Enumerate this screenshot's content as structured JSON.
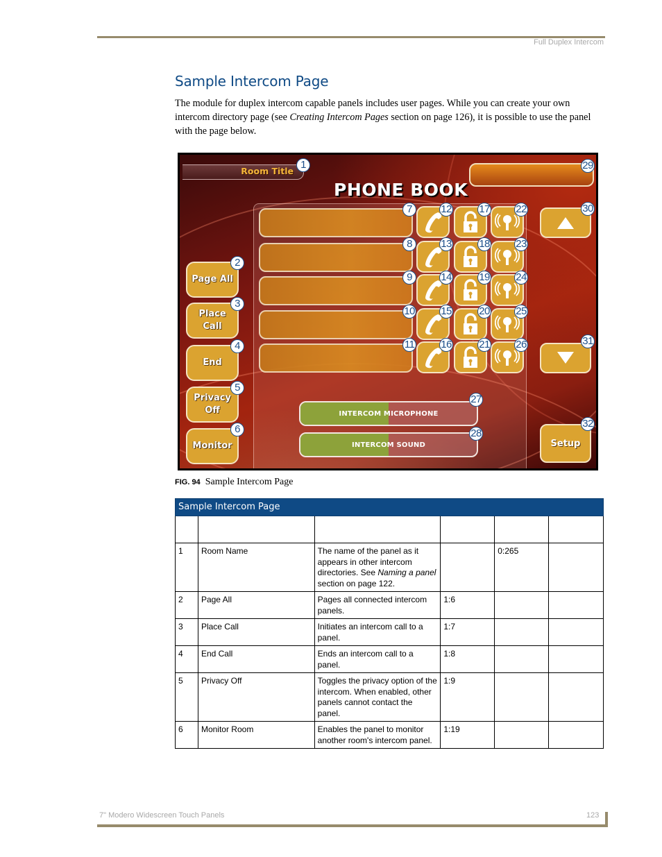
{
  "header": {
    "running_head": "Full Duplex Intercom"
  },
  "section": {
    "title": "Sample Intercom Page",
    "intro_before": "The module for duplex intercom capable panels includes user pages. While you can create your own intercom directory page (see ",
    "intro_link": "Creating Intercom Pages",
    "intro_after": " section on page 126), it is possible to use the panel with the page below."
  },
  "panel": {
    "room_title": "Room Title",
    "title": "PHONE BOOK",
    "side_buttons": [
      {
        "label": "Page All",
        "callout": "2"
      },
      {
        "label": "Place Call",
        "callout": "3"
      },
      {
        "label": "End",
        "callout": "4"
      },
      {
        "label": "Privacy Off",
        "callout": "5"
      },
      {
        "label": "Monitor",
        "callout": "6"
      }
    ],
    "rows": [
      {
        "entry_callout": "7",
        "call_callout": "12",
        "lock_callout": "17",
        "monitor_callout": "22"
      },
      {
        "entry_callout": "8",
        "call_callout": "13",
        "lock_callout": "18",
        "monitor_callout": "23"
      },
      {
        "entry_callout": "9",
        "call_callout": "14",
        "lock_callout": "19",
        "monitor_callout": "24"
      },
      {
        "entry_callout": "10",
        "call_callout": "15",
        "lock_callout": "20",
        "monitor_callout": "25"
      },
      {
        "entry_callout": "11",
        "call_callout": "16",
        "lock_callout": "21",
        "monitor_callout": "26"
      }
    ],
    "icons": {
      "call": "phone-handset-icon",
      "lock": "unlock-padlock-icon",
      "monitor": "monitor-speaker-icon",
      "up": "up-arrow-icon",
      "down": "down-arrow-icon"
    },
    "bars": [
      {
        "label": "INTERCOM MICROPHONE",
        "level_percent": 50,
        "callout": "27"
      },
      {
        "label": "INTERCOM SOUND",
        "level_percent": 50,
        "callout": "28"
      }
    ],
    "room_title_callout": "1",
    "field_callout": "29",
    "up_callout": "30",
    "down_callout": "31",
    "setup": {
      "label": "Setup",
      "callout": "32"
    },
    "colors": {
      "button_gold": "#dba330",
      "bar_green": "#8da23a",
      "callout_blue": "#1c4f8a"
    }
  },
  "figure": {
    "number": "FIG. 94",
    "caption": "Sample Intercom Page"
  },
  "table": {
    "title": "Sample Intercom Page",
    "rows": [
      {
        "num": "1",
        "name": "Room Name",
        "desc_parts": [
          "The name of the panel as it appears in other intercom directories. See ",
          "Naming a panel",
          " section on page 122."
        ],
        "c4": "",
        "c5": "0:265",
        "c6": ""
      },
      {
        "num": "2",
        "name": "Page All",
        "desc": "Pages all connected intercom panels.",
        "c4": "1:6",
        "c5": "",
        "c6": ""
      },
      {
        "num": "3",
        "name": "Place Call",
        "desc": "Initiates an intercom call to a panel.",
        "c4": "1:7",
        "c5": "",
        "c6": ""
      },
      {
        "num": "4",
        "name": "End Call",
        "desc": "Ends an intercom call to a panel.",
        "c4": "1:8",
        "c5": "",
        "c6": ""
      },
      {
        "num": "5",
        "name": "Privacy Off",
        "desc": "Toggles the privacy option of the intercom. When enabled, other panels cannot contact the panel.",
        "c4": "1:9",
        "c5": "",
        "c6": ""
      },
      {
        "num": "6",
        "name": "Monitor Room",
        "desc": "Enables the panel to monitor another room's intercom panel.",
        "c4": "1:19",
        "c5": "",
        "c6": ""
      }
    ]
  },
  "footer": {
    "title": "7\" Modero Widescreen Touch Panels",
    "page": "123"
  }
}
